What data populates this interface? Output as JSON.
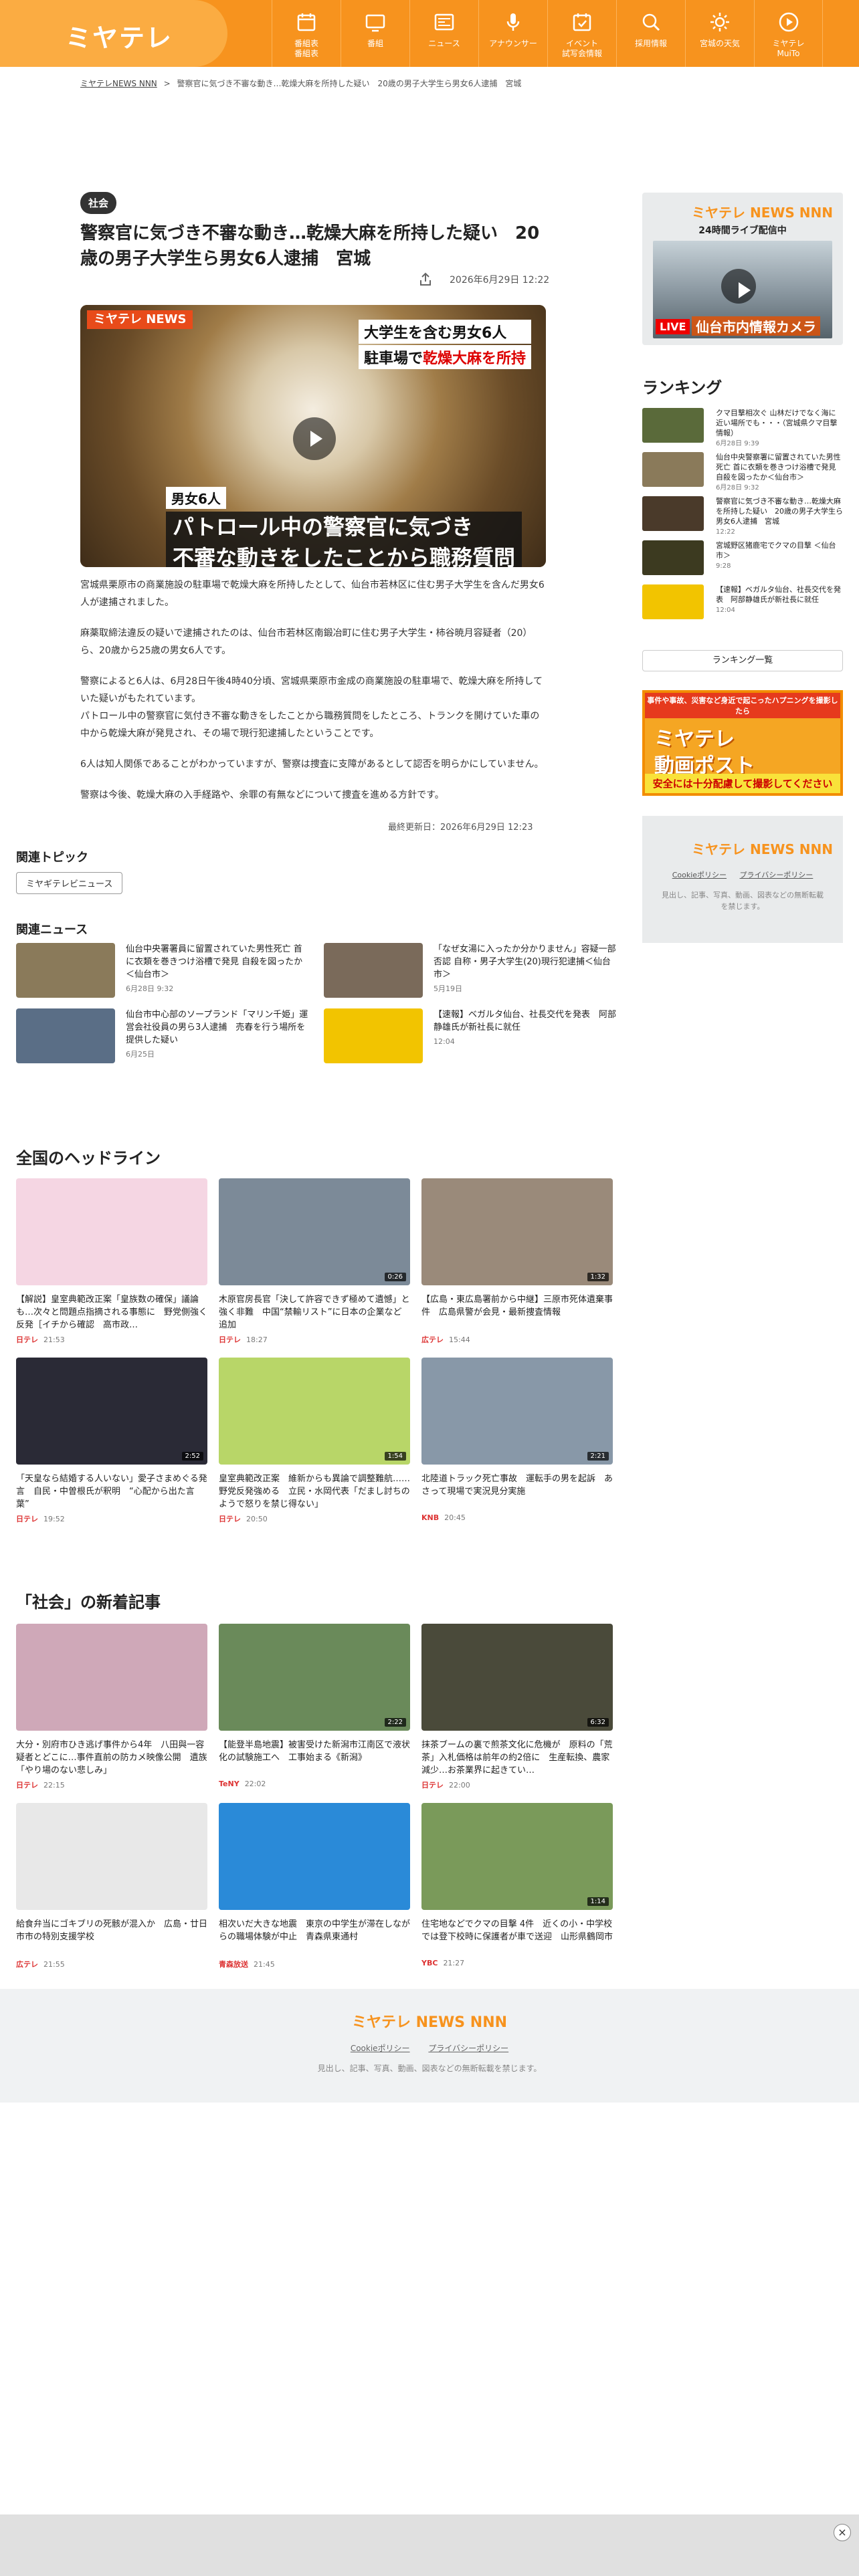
{
  "header": {
    "logo": "ミヤテレ",
    "nav": [
      {
        "label": "番組表\n番組表",
        "icon": "calendar-icon"
      },
      {
        "label": "番組",
        "icon": "tv-icon"
      },
      {
        "label": "ニュース",
        "icon": "news-icon"
      },
      {
        "label": "アナウンサー",
        "icon": "microphone-icon"
      },
      {
        "label": "イベント\n試写会情報",
        "icon": "event-icon"
      },
      {
        "label": "採用情報",
        "icon": "search-person-icon"
      },
      {
        "label": "宮城の天気",
        "icon": "sun-icon"
      },
      {
        "label": "ミヤテレ\nMuiTo",
        "icon": "play-icon"
      }
    ]
  },
  "breadcrumb": {
    "home": "ミヤテレNEWS NNN",
    "sep": ">",
    "current": "警察官に気づき不審な動き…乾燥大麻を所持した疑い　20歳の男子大学生ら男女6人逮捕　宮城"
  },
  "article": {
    "tag": "社会",
    "title": "警察官に気づき不審な動き…乾燥大麻を所持した疑い　20歳の男子大学生ら男女6人逮捕　宮城",
    "date": "2026年6月29日 12:22",
    "video": {
      "logo": "ミヤテレ NEWS",
      "cap1": "大学生を含む男女6人",
      "cap2a": "駐車場で",
      "cap2b": "乾燥大麻を所持",
      "sub_small": "男女6人",
      "sub_big1": "パトロール中の警察官に気づき",
      "sub_big2": "不審な動きをしたことから職務質問"
    },
    "paragraphs": [
      "宮城県栗原市の商業施設の駐車場で乾燥大麻を所持したとして、仙台市若林区に住む男子大学生を含んだ男女6人が逮捕されました。",
      "麻薬取締法違反の疑いで逮捕されたのは、仙台市若林区南鍛冶町に住む男子大学生・柿谷暁月容疑者（20）ら、20歳から25歳の男女6人です。",
      "警察によると6人は、6月28日午後4時40分頃、宮城県栗原市金成の商業施設の駐車場で、乾燥大麻を所持していた疑いがもたれています。\nパトロール中の警察官に気付き不審な動きをしたことから職務質問をしたところ、トランクを開けていた車の中から乾燥大麻が発見され、その場で現行犯逮捕したということです。",
      "6人は知人関係であることがわかっていますが、警察は捜査に支障があるとして認否を明らかにしていません。",
      "警察は今後、乾燥大麻の入手経路や、余罪の有無などについて捜査を進める方針です。"
    ],
    "updated": "最終更新日：2026年6月29日 12:23"
  },
  "related_topic": {
    "heading": "関連トピック",
    "button": "ミヤギテレビニュース"
  },
  "related_news": {
    "heading": "関連ニュース",
    "items": [
      {
        "title": "仙台中央署署員に留置されていた男性死亡 首に衣類を巻きつけ浴槽で発見 自殺を図ったか＜仙台市＞",
        "date": "6月28日 9:32",
        "color": "#8a7a5a"
      },
      {
        "title": "「なぜ女湯に入ったか分かりません」容疑一部否認 自称・男子大学生(20)現行犯逮捕＜仙台市＞",
        "date": "5月19日",
        "color": "#7a6a5a"
      },
      {
        "title": "仙台市中心部のソープランド「マリン千姫」運営会社役員の男ら3人逮捕　売春を行う場所を提供した疑い",
        "date": "6月25日",
        "color": "#5a6e86"
      },
      {
        "title": "【速報】ベガルタ仙台、社長交代を発表　阿部静雄氏が新社長に就任",
        "date": "12:04",
        "color": "#f2c400"
      }
    ]
  },
  "sidebar": {
    "live": {
      "logo": "ミヤテレ NEWS NNN",
      "caption": "24時間ライブ配信中",
      "badge": "LIVE",
      "text": "仙台市内情報カメラ"
    },
    "ranking_heading": "ランキング",
    "ranking": [
      {
        "title": "クマ目撃相次ぐ 山林だけでなく海に近い場所でも・・・（宮城県クマ目撃情報）",
        "date": "6月28日 9:39",
        "color": "#5a6a3a"
      },
      {
        "title": "仙台中央警察署に留置されていた男性死亡 首に衣類を巻きつけ浴槽で発見 自殺を図ったか＜仙台市＞",
        "date": "6月28日 9:32",
        "color": "#8a7a5a"
      },
      {
        "title": "警察官に気づき不審な動き…乾燥大麻を所持した疑い　20歳の男子大学生ら男女6人逮捕　宮城",
        "date": "12:22",
        "color": "#4a3a2a"
      },
      {
        "title": "宮城野区猪鹿宅でクマの目撃 ＜仙台市＞",
        "date": "9:28",
        "color": "#3c3a20"
      },
      {
        "title": "【速報】ベガルタ仙台、社長交代を発表　阿部静雄氏が新社長に就任",
        "date": "12:04",
        "color": "#f2c400"
      }
    ],
    "ranking_more": "ランキング一覧",
    "banner": {
      "top": "事件や事故、災害など身近で起こったハプニングを撮影したら",
      "main1": "ミヤテレ",
      "main2": "動画ポスト",
      "bottom": "安全には十分配慮して撮影してください"
    },
    "footer": {
      "logo": "ミヤテレ NEWS NNN",
      "link1": "Cookieポリシー",
      "link2": "プライバシーポリシー",
      "copy": "見出し、記事、写真、動画、図表などの無断転載を禁じます。"
    }
  },
  "national": {
    "heading": "全国のヘッドライン",
    "items": [
      {
        "title": "【解説】皇室典範改正案「皇族数の確保」議論も…次々と問題点指摘される事態に　野党側強く反発［イチから確認　高市政…",
        "source": "日テレ",
        "time": "21:53",
        "dur": "",
        "color": "#f5d6e3"
      },
      {
        "title": "木原官房長官「決して許容できず極めて遺憾」と強く非難　中国“禁輸リスト”に日本の企業など追加",
        "source": "日テレ",
        "time": "18:27",
        "dur": "0:26",
        "color": "#7c8a98"
      },
      {
        "title": "【広島・東広島署前から中継】三原市死体遺棄事件　広島県警が会見・最新捜査情報",
        "source": "広テレ",
        "time": "15:44",
        "dur": "1:32",
        "color": "#9a8a7a"
      },
      {
        "title": "「天皇なら結婚する人いない」愛子さまめぐる発言　自民・中曽根氏が釈明　“心配から出た言葉”",
        "source": "日テレ",
        "time": "19:52",
        "dur": "2:52",
        "color": "#2a2a36"
      },
      {
        "title": "皇室典範改正案　維新からも異論で調整難航……野党反発強める　立民・水岡代表「だまし討ちのようで怒りを禁じ得ない」",
        "source": "日テレ",
        "time": "20:50",
        "dur": "1:54",
        "color": "#b8d668"
      },
      {
        "title": "北陸道トラック死亡事故　運転手の男を起訴　あさって現場で実況見分実施",
        "source": "KNB",
        "time": "20:45",
        "dur": "2:21",
        "color": "#8898a8"
      }
    ]
  },
  "social": {
    "heading": "「社会」の新着記事",
    "items": [
      {
        "title": "大分・別府市ひき逃げ事件から4年　八田與一容疑者とどこに…事件直前の防カメ映像公開　遺族「やり場のない悲しみ」",
        "source": "日テレ",
        "time": "22:15",
        "dur": "",
        "color": "#cfa8b8"
      },
      {
        "title": "【能登半島地震】被害受けた新潟市江南区で液状化の試験施工へ　工事始まる《新潟》",
        "source": "TeNY",
        "time": "22:02",
        "dur": "2:22",
        "color": "#6a8a5a"
      },
      {
        "title": "抹茶ブームの裏で煎茶文化に危機が　原料の「荒茶」入札価格は前年の約2倍に　生産転換、農家減少…お茶業界に起きてい…",
        "source": "日テレ",
        "time": "22:00",
        "dur": "6:32",
        "color": "#4a4a3a"
      },
      {
        "title": "給食弁当にゴキブリの死骸が混入か　広島・廿日市市の特別支援学校",
        "source": "広テレ",
        "time": "21:55",
        "dur": "",
        "color": "#e8e8e8"
      },
      {
        "title": "相次いだ大きな地震　東京の中学生が滞在しながらの職場体験が中止　青森県東通村",
        "source": "青森放送",
        "time": "21:45",
        "dur": "",
        "color": "#2a8ad8"
      },
      {
        "title": "住宅地などでクマの目撃 4件　近くの小・中学校では登下校時に保護者が車で送迎　山形県鶴岡市",
        "source": "YBC",
        "time": "21:27",
        "dur": "1:14",
        "color": "#7a9a5a"
      }
    ]
  },
  "footer": {
    "logo": "ミヤテレ NEWS NNN",
    "link1": "Cookieポリシー",
    "link2": "プライバシーポリシー",
    "copy": "見出し、記事、写真、動画、図表などの無断転載を禁じます。"
  },
  "ad": {
    "close": "×"
  }
}
